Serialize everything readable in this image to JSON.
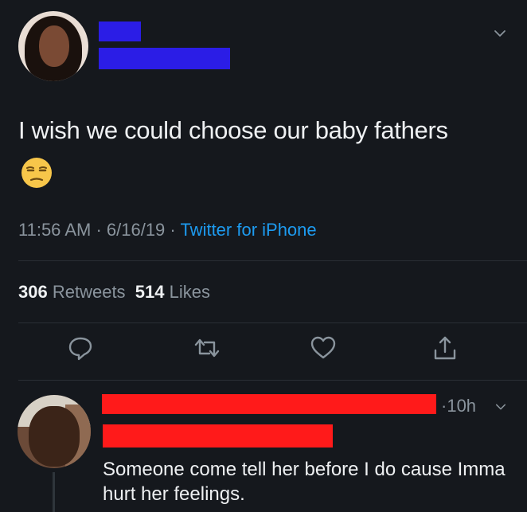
{
  "tweet": {
    "text": "I wish we could choose our baby fathers",
    "emoji": "unamused-face",
    "time": "11:56 AM",
    "date": "6/16/19",
    "source": "Twitter for iPhone",
    "separator": " · ",
    "retweets_count": "306",
    "retweets_label": "Retweets",
    "likes_count": "514",
    "likes_label": "Likes"
  },
  "reply": {
    "time": "10h",
    "time_prefix": "·",
    "text": "Someone come tell her before I do cause Imma hurt her feelings."
  },
  "icons": {
    "reply": "speech-bubble-icon",
    "retweet": "retweet-icon",
    "like": "heart-icon",
    "share": "share-icon",
    "more": "chevron-down-icon"
  },
  "colors": {
    "background": "#15181d",
    "link": "#1d9bf0",
    "redaction_blue": "#2b1de6",
    "redaction_red": "#ff1a1a"
  }
}
